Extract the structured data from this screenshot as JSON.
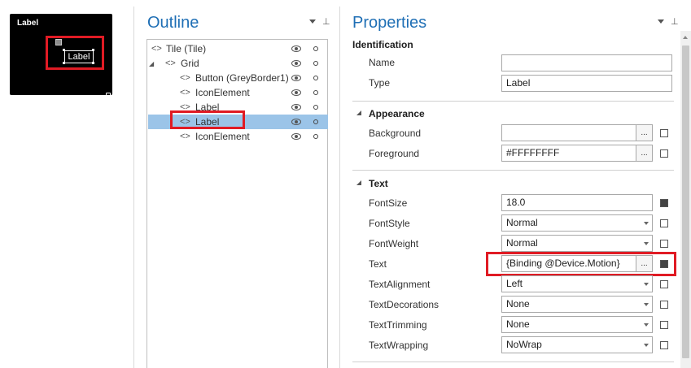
{
  "tile": {
    "title": "Label",
    "label_text": "Label"
  },
  "outline": {
    "title": "Outline",
    "items": [
      {
        "label": "Tile (Tile)",
        "tag": "<>",
        "expanded": true,
        "selected": false
      },
      {
        "label": "Grid",
        "tag": "<>",
        "expanded": true,
        "selected": false
      },
      {
        "label": "Button (GreyBorder1)",
        "tag": "<>",
        "selected": false
      },
      {
        "label": "IconElement",
        "tag": "<>",
        "selected": false
      },
      {
        "label": "Label",
        "tag": "<>",
        "selected": false
      },
      {
        "label": "Label",
        "tag": "<>",
        "selected": true
      },
      {
        "label": "IconElement",
        "tag": "<>",
        "selected": false
      }
    ]
  },
  "properties": {
    "title": "Properties",
    "identification": {
      "header": "Identification",
      "name_label": "Name",
      "name_value": "",
      "type_label": "Type",
      "type_value": "Label"
    },
    "appearance": {
      "header": "Appearance",
      "background_label": "Background",
      "background_value": "",
      "foreground_label": "Foreground",
      "foreground_value": "#FFFFFFFF"
    },
    "text": {
      "header": "Text",
      "fontsize_label": "FontSize",
      "fontsize_value": "18.0",
      "fontstyle_label": "FontStyle",
      "fontstyle_value": "Normal",
      "fontweight_label": "FontWeight",
      "fontweight_value": "Normal",
      "text_label": "Text",
      "text_value": "{Binding @Device.Motion}",
      "textalignment_label": "TextAlignment",
      "textalignment_value": "Left",
      "textdecorations_label": "TextDecorations",
      "textdecorations_value": "None",
      "texttrimming_label": "TextTrimming",
      "texttrimming_value": "None",
      "textwrapping_label": "TextWrapping",
      "textwrapping_value": "NoWrap"
    },
    "ellipsis": "..."
  },
  "colors": {
    "accent": "#1f6fb5",
    "highlight": "#e01b24",
    "selection": "#9bc4e8"
  }
}
